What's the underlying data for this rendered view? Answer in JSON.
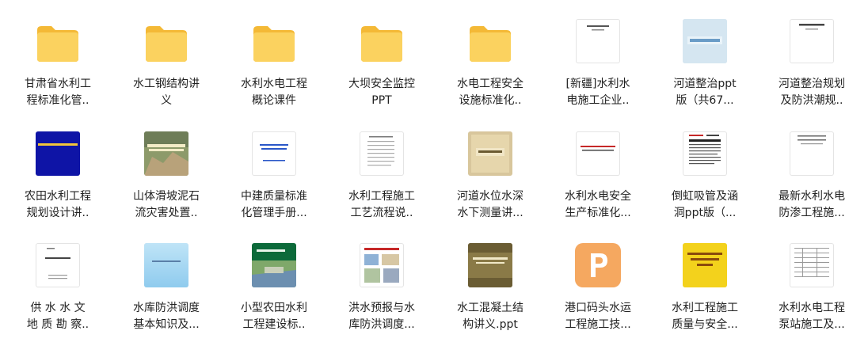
{
  "files": [
    {
      "label": "甘肃省水利工\n程标准化管..",
      "icon": "folder-icon"
    },
    {
      "label": "水工钢结构讲\n义",
      "icon": "folder-icon"
    },
    {
      "label": "水利水电工程\n概论课件",
      "icon": "folder-icon"
    },
    {
      "label": "大坝安全监控\nPPT",
      "icon": "folder-icon"
    },
    {
      "label": "水电工程安全\n设施标准化..",
      "icon": "folder-icon"
    },
    {
      "label": "[新疆]水利水\n电施工企业..",
      "icon": "document-thumbnail-icon"
    },
    {
      "label": "河道整治ppt\n版（共67...",
      "icon": "slide-thumbnail-icon",
      "thumb_text": "河道（渠道）整治"
    },
    {
      "label": "河道整治规划\n及防洪潮规..",
      "icon": "document-thumbnail-icon"
    },
    {
      "label": "农田水利工程\n规划设计讲..",
      "icon": "slide-thumbnail-icon"
    },
    {
      "label": "山体滑坡泥石\n流灾害处置..",
      "icon": "photo-slide-thumbnail-icon"
    },
    {
      "label": "中建质量标准\n化管理手册...",
      "icon": "slide-thumbnail-icon"
    },
    {
      "label": "水利工程施工\n工艺流程说..",
      "icon": "document-thumbnail-icon"
    },
    {
      "label": "河道水位水深\n水下测量讲...",
      "icon": "slide-thumbnail-icon"
    },
    {
      "label": "水利水电安全\n生产标准化...",
      "icon": "slide-thumbnail-icon"
    },
    {
      "label": "倒虹吸管及涵\n洞ppt版（...",
      "icon": "document-thumbnail-icon"
    },
    {
      "label": "最新水利水电\n防渗工程施...",
      "icon": "document-thumbnail-icon"
    },
    {
      "label": "供 水 水 文\n地 质 勘 察..",
      "icon": "document-thumbnail-icon"
    },
    {
      "label": "水库防洪调度\n基本知识及...",
      "icon": "slide-thumbnail-icon"
    },
    {
      "label": "小型农田水利\n工程建设标..",
      "icon": "photo-slide-thumbnail-icon"
    },
    {
      "label": "洪水预报与水\n库防洪调度...",
      "icon": "photo-slide-thumbnail-icon"
    },
    {
      "label": "水工混凝土结\n构讲义.ppt",
      "icon": "slide-thumbnail-icon"
    },
    {
      "label": "港口码头水运\n工程施工技...",
      "icon": "ppt-file-icon"
    },
    {
      "label": "水利工程施工\n质量与安全...",
      "icon": "slide-thumbnail-icon"
    },
    {
      "label": "水利水电工程\n泵站施工及...",
      "icon": "document-thumbnail-icon"
    }
  ],
  "colors": {
    "folder": "#f7c645",
    "ppt": "#f5a860"
  }
}
